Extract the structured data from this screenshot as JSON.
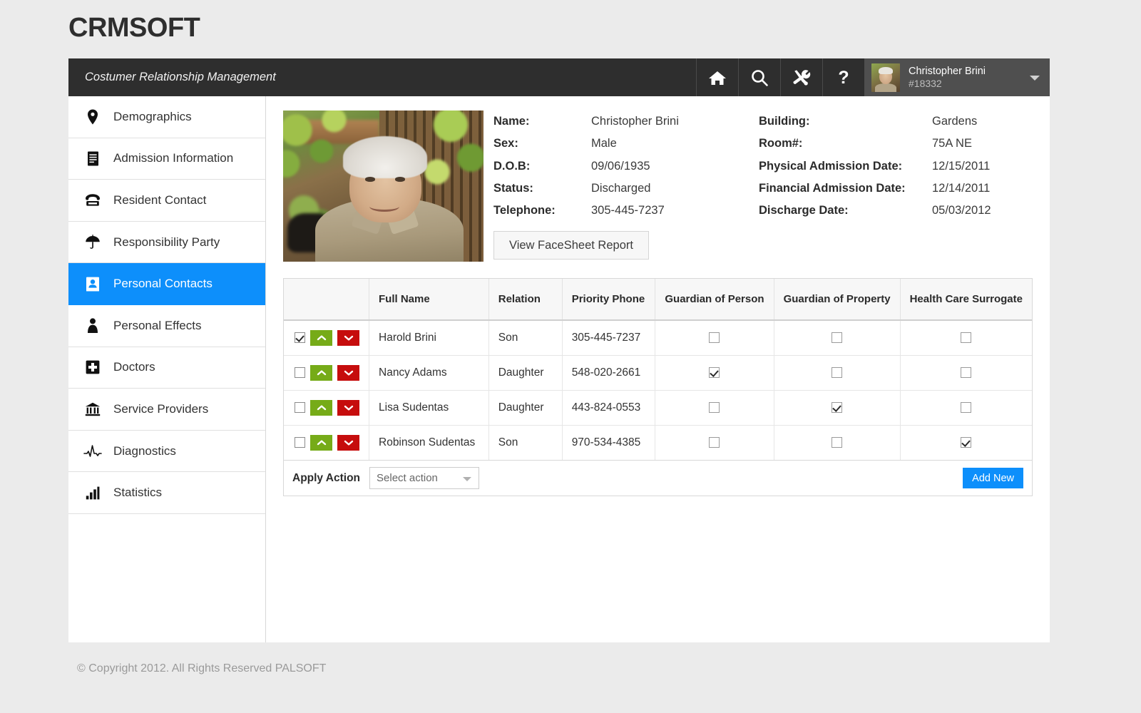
{
  "brand": "CRMSOFT",
  "topbar": {
    "title": "Costumer Relationship Management",
    "tools": [
      {
        "name": "home-icon",
        "label": "Home"
      },
      {
        "name": "search-icon",
        "label": "Search"
      },
      {
        "name": "tools-icon",
        "label": "Tools"
      },
      {
        "name": "help-icon",
        "label": "Help"
      }
    ],
    "user": {
      "name": "Christopher Brini",
      "id": "#18332"
    }
  },
  "sidebar": {
    "items": [
      {
        "label": "Demographics",
        "icon": "map-pin-icon",
        "active": false
      },
      {
        "label": "Admission Information",
        "icon": "document-icon",
        "active": false
      },
      {
        "label": "Resident Contact",
        "icon": "telephone-icon",
        "active": false
      },
      {
        "label": "Responsibility Party",
        "icon": "umbrella-icon",
        "active": false
      },
      {
        "label": "Personal Contacts",
        "icon": "contact-card-icon",
        "active": true
      },
      {
        "label": "Personal Effects",
        "icon": "person-icon",
        "active": false
      },
      {
        "label": "Doctors",
        "icon": "medical-cross-icon",
        "active": false
      },
      {
        "label": "Service Providers",
        "icon": "bank-icon",
        "active": false
      },
      {
        "label": "Diagnostics",
        "icon": "pulse-icon",
        "active": false
      },
      {
        "label": "Statistics",
        "icon": "bar-chart-icon",
        "active": false
      }
    ]
  },
  "patient": {
    "left_fields": [
      {
        "label": "Name:",
        "value": "Christopher Brini"
      },
      {
        "label": "Sex:",
        "value": "Male"
      },
      {
        "label": "D.O.B:",
        "value": "09/06/1935"
      },
      {
        "label": "Status:",
        "value": "Discharged"
      },
      {
        "label": "Telephone:",
        "value": "305-445-7237"
      }
    ],
    "right_fields": [
      {
        "label": "Building:",
        "value": "Gardens"
      },
      {
        "label": "Room#:",
        "value": "75A NE"
      },
      {
        "label": "Physical Admission Date:",
        "value": "12/15/2011"
      },
      {
        "label": "Financial Admission Date:",
        "value": "12/14/2011"
      },
      {
        "label": "Discharge Date:",
        "value": "05/03/2012"
      }
    ],
    "facesheet_button": "View FaceSheet Report"
  },
  "contacts_table": {
    "columns": [
      "",
      "Full Name",
      "Relation",
      "Priority Phone",
      "Guardian of Person",
      "Guardian of Property",
      "Health Care Surrogate"
    ],
    "rows": [
      {
        "selected": true,
        "full_name": "Harold Brini",
        "relation": "Son",
        "priority_phone": "305-445-7237",
        "guardian_of_person": false,
        "guardian_of_property": false,
        "health_care_surrogate": false
      },
      {
        "selected": false,
        "full_name": "Nancy Adams",
        "relation": "Daughter",
        "priority_phone": "548-020-2661",
        "guardian_of_person": true,
        "guardian_of_property": false,
        "health_care_surrogate": false
      },
      {
        "selected": false,
        "full_name": "Lisa Sudentas",
        "relation": "Daughter",
        "priority_phone": "443-824-0553",
        "guardian_of_person": false,
        "guardian_of_property": true,
        "health_care_surrogate": false
      },
      {
        "selected": false,
        "full_name": "Robinson Sudentas",
        "relation": "Son",
        "priority_phone": "970-534-4385",
        "guardian_of_person": false,
        "guardian_of_property": false,
        "health_care_surrogate": true
      }
    ],
    "footer": {
      "apply_action_label": "Apply Action",
      "select_value": "Select action",
      "add_new_label": "Add New"
    }
  },
  "footer": {
    "copyright": "© Copyright 2012. All Rights Reserved PALSOFT"
  },
  "colors": {
    "accent": "#0d8ffb",
    "topbar": "#2e2e2e",
    "user_panel": "#4f4f4f",
    "move_up": "#76ab18",
    "move_down": "#c60d0d",
    "page_bg": "#ebebeb"
  }
}
